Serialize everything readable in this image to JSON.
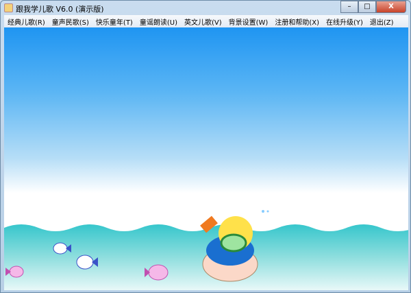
{
  "window": {
    "title": "跟我学儿歌 V6.0 (演示版)",
    "controls": {
      "minimize": "–",
      "maximize": "□",
      "close": "X"
    }
  },
  "menu": [
    "经典儿歌(R)",
    "童声民歌(S)",
    "快乐童年(T)",
    "童谣朗读(U)",
    "英文儿歌(V)",
    "背景设置(W)",
    "注册和帮助(X)",
    "在线升级(Y)",
    "退出(Z)"
  ],
  "colors": {
    "sky_top": "#1f95f2",
    "sea": "#3ecbd0"
  }
}
